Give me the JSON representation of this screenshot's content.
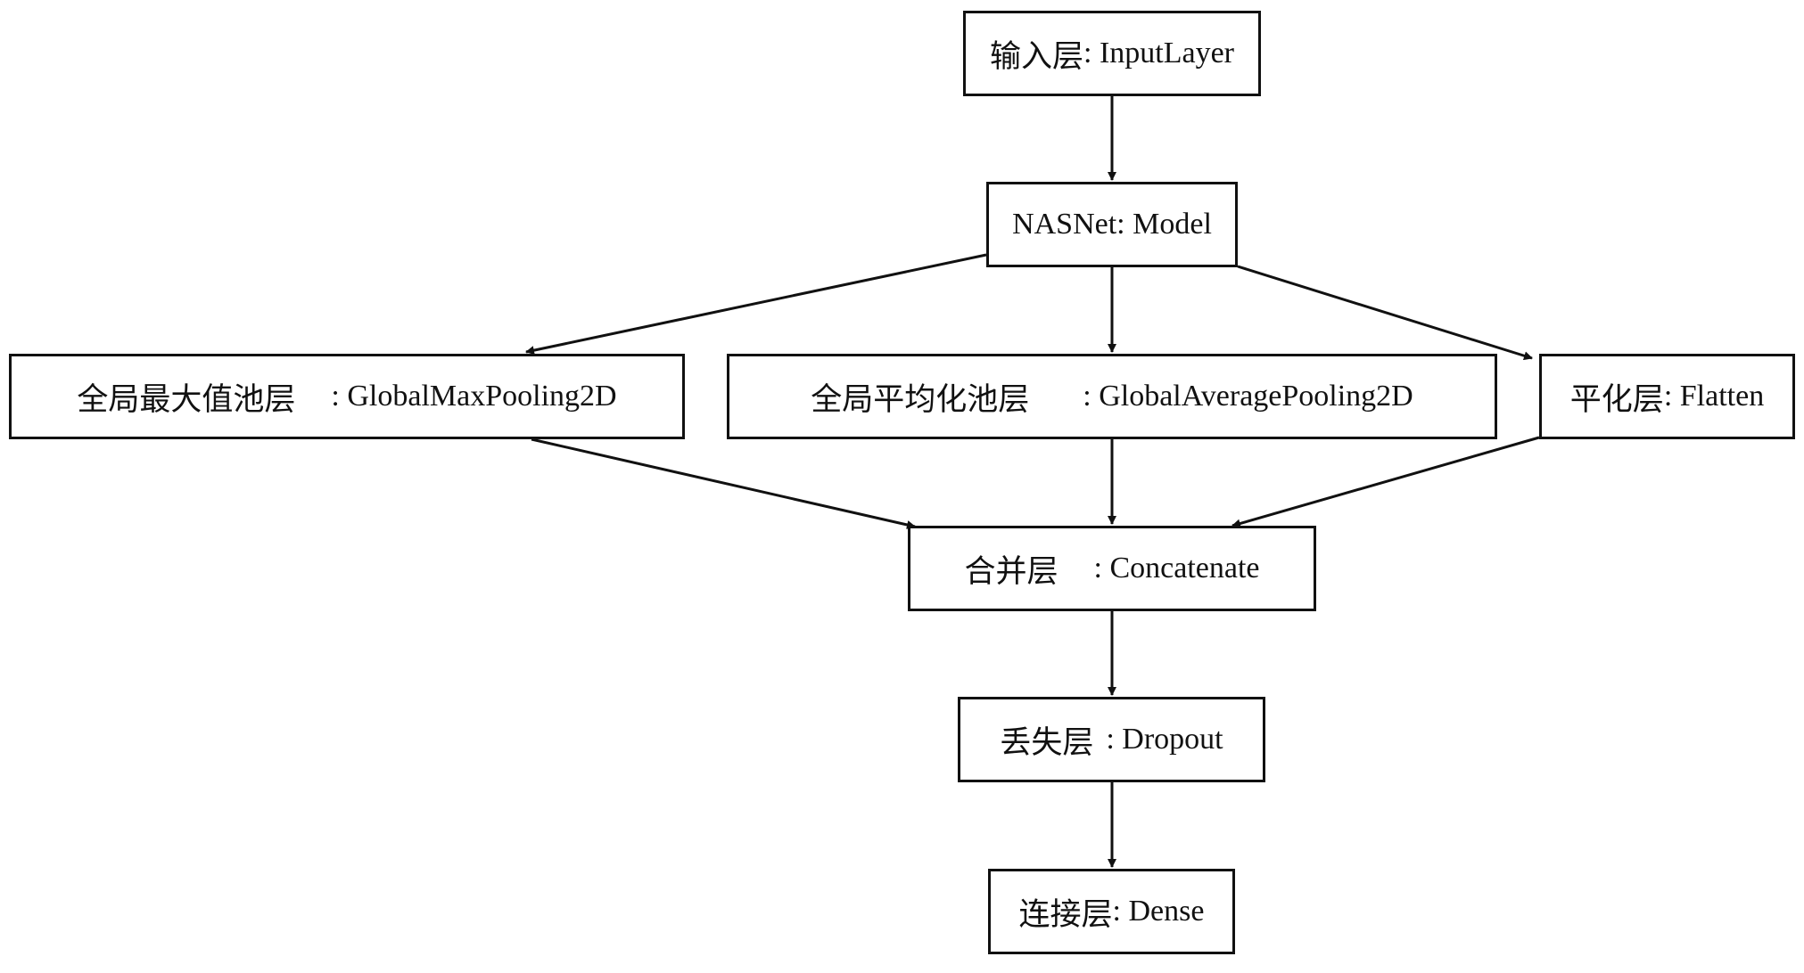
{
  "diagram": {
    "nodes": {
      "input": {
        "cn": "输入层",
        "en": ": InputLayer"
      },
      "nasnet": {
        "cn": "",
        "en": "NASNet: Model"
      },
      "gmp": {
        "cn": "全局最大值池层",
        "en": ": GlobalMaxPooling2D"
      },
      "gap": {
        "cn": "全局平均化池层",
        "en": ": GlobalAveragePooling2D"
      },
      "flat": {
        "cn": "平化层",
        "en": ": Flatten"
      },
      "concat": {
        "cn": "合并层",
        "en": ": Concatenate"
      },
      "drop": {
        "cn": "丢失层",
        "en": ": Dropout"
      },
      "dense": {
        "cn": "连接层",
        "en": ": Dense"
      }
    },
    "edges": [
      [
        "input",
        "nasnet"
      ],
      [
        "nasnet",
        "gmp"
      ],
      [
        "nasnet",
        "gap"
      ],
      [
        "nasnet",
        "flat"
      ],
      [
        "gmp",
        "concat"
      ],
      [
        "gap",
        "concat"
      ],
      [
        "flat",
        "concat"
      ],
      [
        "concat",
        "drop"
      ],
      [
        "drop",
        "dense"
      ]
    ],
    "colors": {
      "line": "#111111",
      "box_border": "#111111",
      "background": "#ffffff"
    }
  }
}
